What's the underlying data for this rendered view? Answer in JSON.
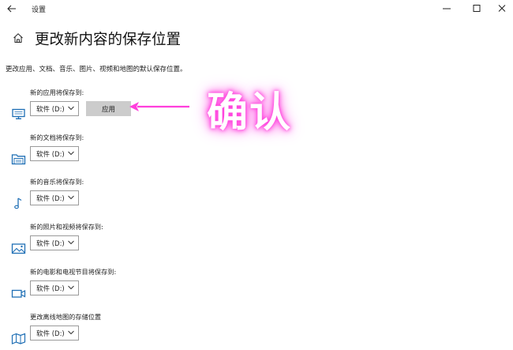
{
  "window": {
    "title": "设置",
    "back_icon": "back-arrow-icon",
    "controls": [
      "minimize-icon",
      "maximize-icon",
      "close-icon"
    ]
  },
  "page": {
    "title": "更改新内容的保存位置",
    "home_icon": "home-icon",
    "description": "更改应用、文档、音乐、图片、视频和地图的默认保存位置。"
  },
  "rows": [
    {
      "label": "新的应用将保存到:",
      "drive": "软件 (D:)",
      "icon": "monitor-icon",
      "apply_label": "应用"
    },
    {
      "label": "新的文档将保存到:",
      "drive": "软件 (D:)",
      "icon": "folder-icon"
    },
    {
      "label": "新的音乐将保存到:",
      "drive": "软件 (D:)",
      "icon": "music-note-icon"
    },
    {
      "label": "新的照片和视频将保存到:",
      "drive": "软件 (D:)",
      "icon": "picture-icon"
    },
    {
      "label": "新的电影和电视节目将保存到:",
      "drive": "软件 (D:)",
      "icon": "video-camera-icon"
    },
    {
      "label": "更改离线地图的存储位置",
      "drive": "软件 (D:)",
      "icon": "map-icon"
    }
  ],
  "annotation": {
    "text": "确认",
    "color": "#ff3fdc"
  },
  "colors": {
    "icon_blue": "#1f6fb5",
    "button_gray": "#cccccc"
  }
}
